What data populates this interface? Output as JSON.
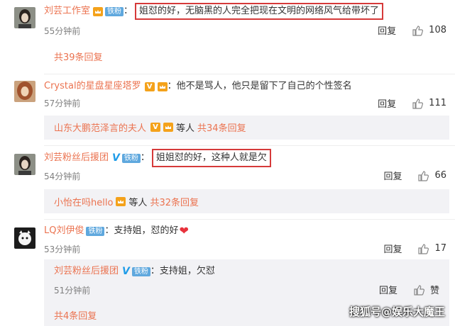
{
  "comments": [
    {
      "username": "刘芸工作室",
      "badge": "铁粉",
      "text": "姐怼的好，无脑黑的人完全把现在文明的网络风气给带坏了",
      "time": "55分钟前",
      "reply_label": "回复",
      "likes": "108",
      "thread_link": "共39条回复"
    },
    {
      "username": "Crystal的星盘星座塔罗",
      "text": "他不是骂人，他只是留下了自己的个性签名",
      "time": "57分钟前",
      "reply_label": "回复",
      "likes": "111",
      "thread_user": "山东大鹏范泽言的夫人",
      "thread_mid": "等人",
      "thread_count": "共34条回复"
    },
    {
      "username": "刘芸粉丝后援团",
      "badge": "铁粉",
      "text": "姐姐怼的好，这种人就是欠",
      "time": "54分钟前",
      "reply_label": "回复",
      "likes": "66",
      "thread_user": "小怡在吗hello",
      "thread_mid": "等人",
      "thread_count": "共32条回复"
    },
    {
      "username": "LQ刘伊俊",
      "badge": "铁粉",
      "text": "支持姐，怼的好",
      "time": "53分钟前",
      "reply_label": "回复",
      "likes": "17",
      "nested": {
        "username": "刘芸粉丝后援团",
        "badge": "铁粉",
        "text": "支持姐，欠怼",
        "time": "51分钟前",
        "reply_label": "回复",
        "like_label": "赞"
      },
      "thread_link": "共4条回复"
    }
  ],
  "watermark": "搜狐号@娱乐大魔王",
  "colors": {
    "accent": "#eb7350",
    "highlight_box": "#d63a3a",
    "reply_bg": "#f2f2f5"
  }
}
